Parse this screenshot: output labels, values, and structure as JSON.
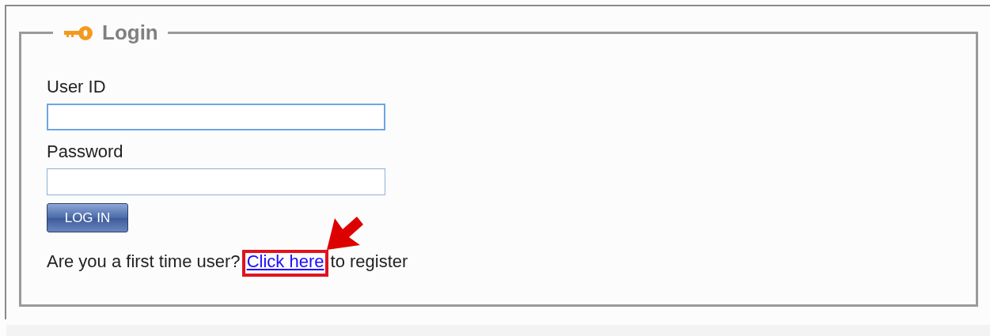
{
  "legend": "Login",
  "fields": [
    {
      "label": "User ID",
      "focused": true
    },
    {
      "label": "Password",
      "focused": false
    }
  ],
  "button": "LOG IN",
  "register": {
    "prefix": "Are you a first time user?",
    "link": "Click here",
    "suffix": "to register",
    "highlighted": true
  }
}
